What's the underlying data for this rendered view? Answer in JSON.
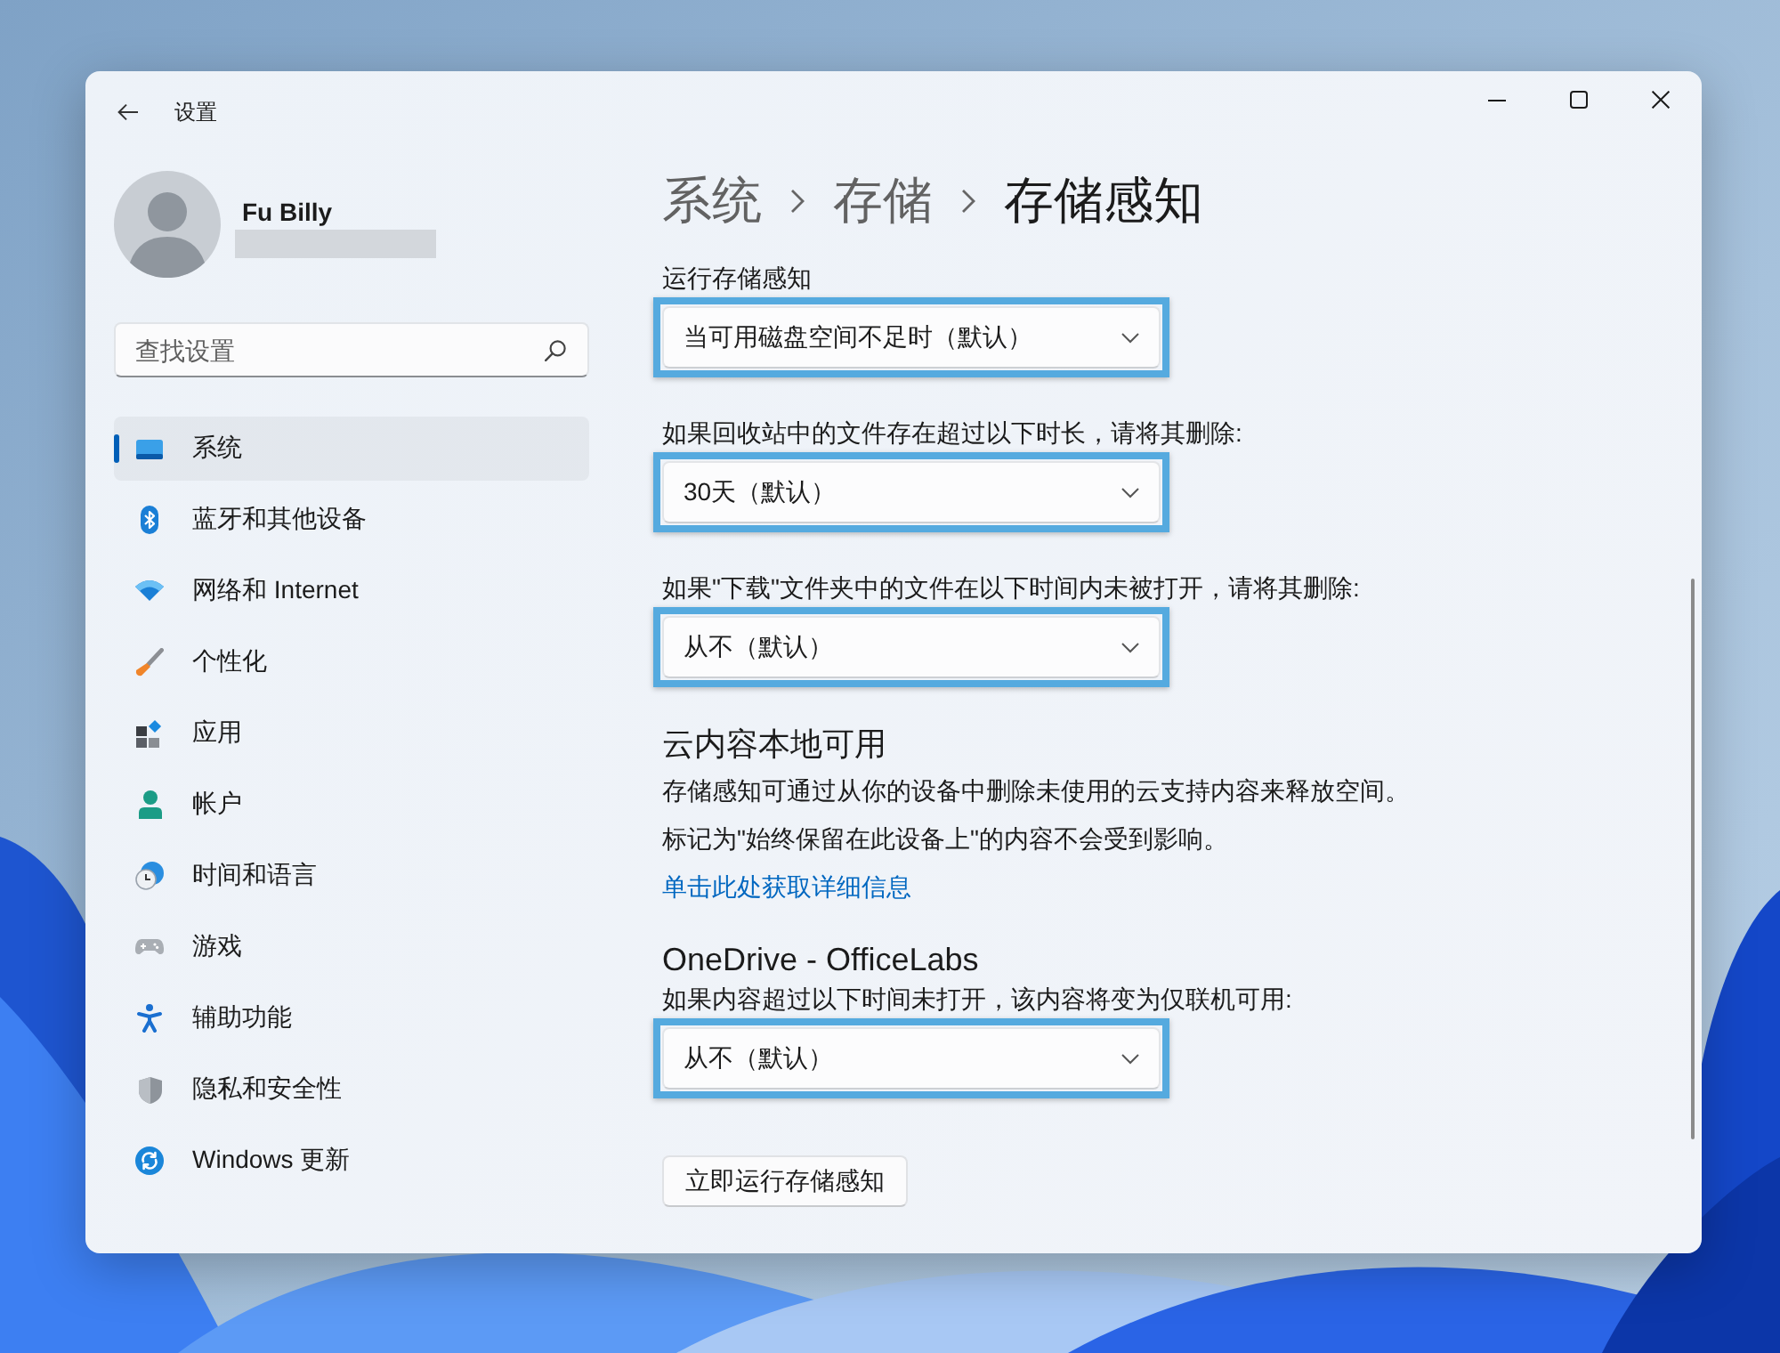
{
  "window": {
    "title": "设置"
  },
  "account": {
    "name": "Fu Billy"
  },
  "search": {
    "placeholder": "查找设置"
  },
  "sidebar": {
    "items": [
      {
        "label": "系统",
        "selected": true
      },
      {
        "label": "蓝牙和其他设备",
        "selected": false
      },
      {
        "label": "网络和 Internet",
        "selected": false
      },
      {
        "label": "个性化",
        "selected": false
      },
      {
        "label": "应用",
        "selected": false
      },
      {
        "label": "帐户",
        "selected": false
      },
      {
        "label": "时间和语言",
        "selected": false
      },
      {
        "label": "游戏",
        "selected": false
      },
      {
        "label": "辅助功能",
        "selected": false
      },
      {
        "label": "隐私和安全性",
        "selected": false
      },
      {
        "label": "Windows 更新",
        "selected": false
      }
    ]
  },
  "breadcrumb": [
    {
      "label": "系统",
      "current": false
    },
    {
      "label": "存储",
      "current": false
    },
    {
      "label": "存储感知",
      "current": true
    }
  ],
  "settings": [
    {
      "kind": "dropdown",
      "label": "运行存储感知",
      "value": "当可用磁盘空间不足时（默认）",
      "highlighted": true
    },
    {
      "kind": "dropdown",
      "label": "如果回收站中的文件存在超过以下时长，请将其删除:",
      "value": "30天（默认）",
      "highlighted": true
    },
    {
      "kind": "dropdown",
      "label": "如果\"下载\"文件夹中的文件在以下时间内未被打开，请将其删除:",
      "value": "从不（默认）",
      "highlighted": true
    },
    {
      "kind": "heading",
      "text": "云内容本地可用"
    },
    {
      "kind": "paragraph",
      "text": "存储感知可通过从你的设备中删除未使用的云支持内容来释放空间。"
    },
    {
      "kind": "paragraph",
      "text": "标记为\"始终保留在此设备上\"的内容不会受到影响。"
    },
    {
      "kind": "link",
      "text": "单击此处获取详细信息"
    },
    {
      "kind": "heading",
      "text": "OneDrive - OfficeLabs"
    },
    {
      "kind": "dropdown",
      "label": "如果内容超过以下时间未打开，该内容将变为仅联机可用:",
      "value": "从不（默认）",
      "highlighted": true
    },
    {
      "kind": "button",
      "text": "立即运行存储感知"
    }
  ]
}
